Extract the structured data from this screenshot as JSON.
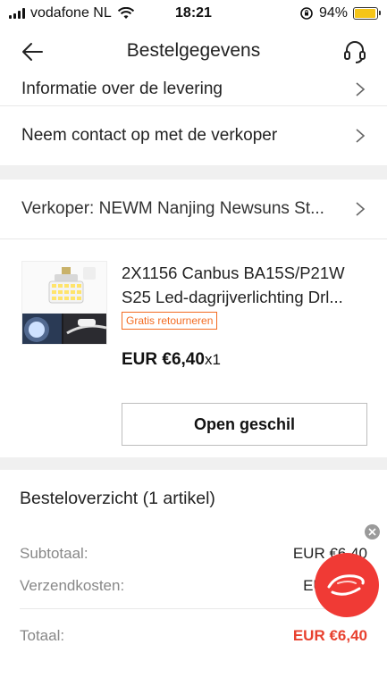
{
  "status_bar": {
    "carrier": "vodafone NL",
    "time": "18:21",
    "battery_text": "94%",
    "battery_level": 0.94
  },
  "header": {
    "title": "Bestelgegevens"
  },
  "rows": {
    "delivery_info": "Informatie over de levering",
    "contact_seller": "Neem contact op met de verkoper",
    "seller": "Verkoper: NEWM Nanjing Newsuns St..."
  },
  "product": {
    "title_line1": "2X1156 Canbus BA15S/P21W",
    "title_line2": "S25 Led-dagrijverlichting Drl...",
    "badge": "Gratis retourneren",
    "price": "EUR €6,40",
    "quantity": "x1"
  },
  "buttons": {
    "open_dispute": "Open geschil"
  },
  "summary": {
    "title": "Besteloverzicht (1 artikel)",
    "subtotal_label": "Subtotaal:",
    "subtotal_value": "EUR €6,40",
    "shipping_label": "Verzendkosten:",
    "shipping_value": "EUR",
    "total_label": "Totaal:",
    "total_value": "EUR €6,40"
  },
  "colors": {
    "accent": "#e8412f",
    "badge": "#f36b21",
    "float_button": "#f03a35",
    "battery": "#f5c518"
  },
  "icons": [
    "back-arrow-icon",
    "headset-icon",
    "chevron-right-icon",
    "close-icon",
    "wifi-icon",
    "signal-icon",
    "battery-icon",
    "orientation-lock-icon"
  ]
}
